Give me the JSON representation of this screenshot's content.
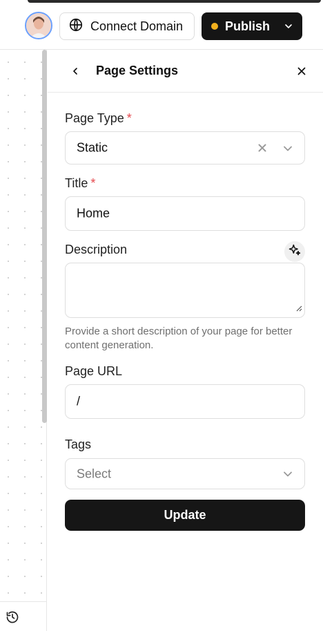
{
  "topbar": {
    "connect_domain_label": "Connect Domain",
    "publish_label": "Publish",
    "publish_status_color": "#f2b01e"
  },
  "panel": {
    "title": "Page Settings",
    "page_type": {
      "label": "Page Type",
      "required_mark": "*",
      "value": "Static"
    },
    "title_field": {
      "label": "Title",
      "required_mark": "*",
      "value": "Home"
    },
    "description": {
      "label": "Description",
      "value": "",
      "help": "Provide a short description of your page for better content generation."
    },
    "page_url": {
      "label": "Page URL",
      "value": "/"
    },
    "tags": {
      "label": "Tags",
      "placeholder": "Select"
    },
    "update_label": "Update"
  },
  "icons": [
    "globe-icon",
    "chevron-down-icon",
    "back-chevron-icon",
    "close-icon",
    "clear-x-icon",
    "sparkle-icon",
    "history-icon"
  ]
}
